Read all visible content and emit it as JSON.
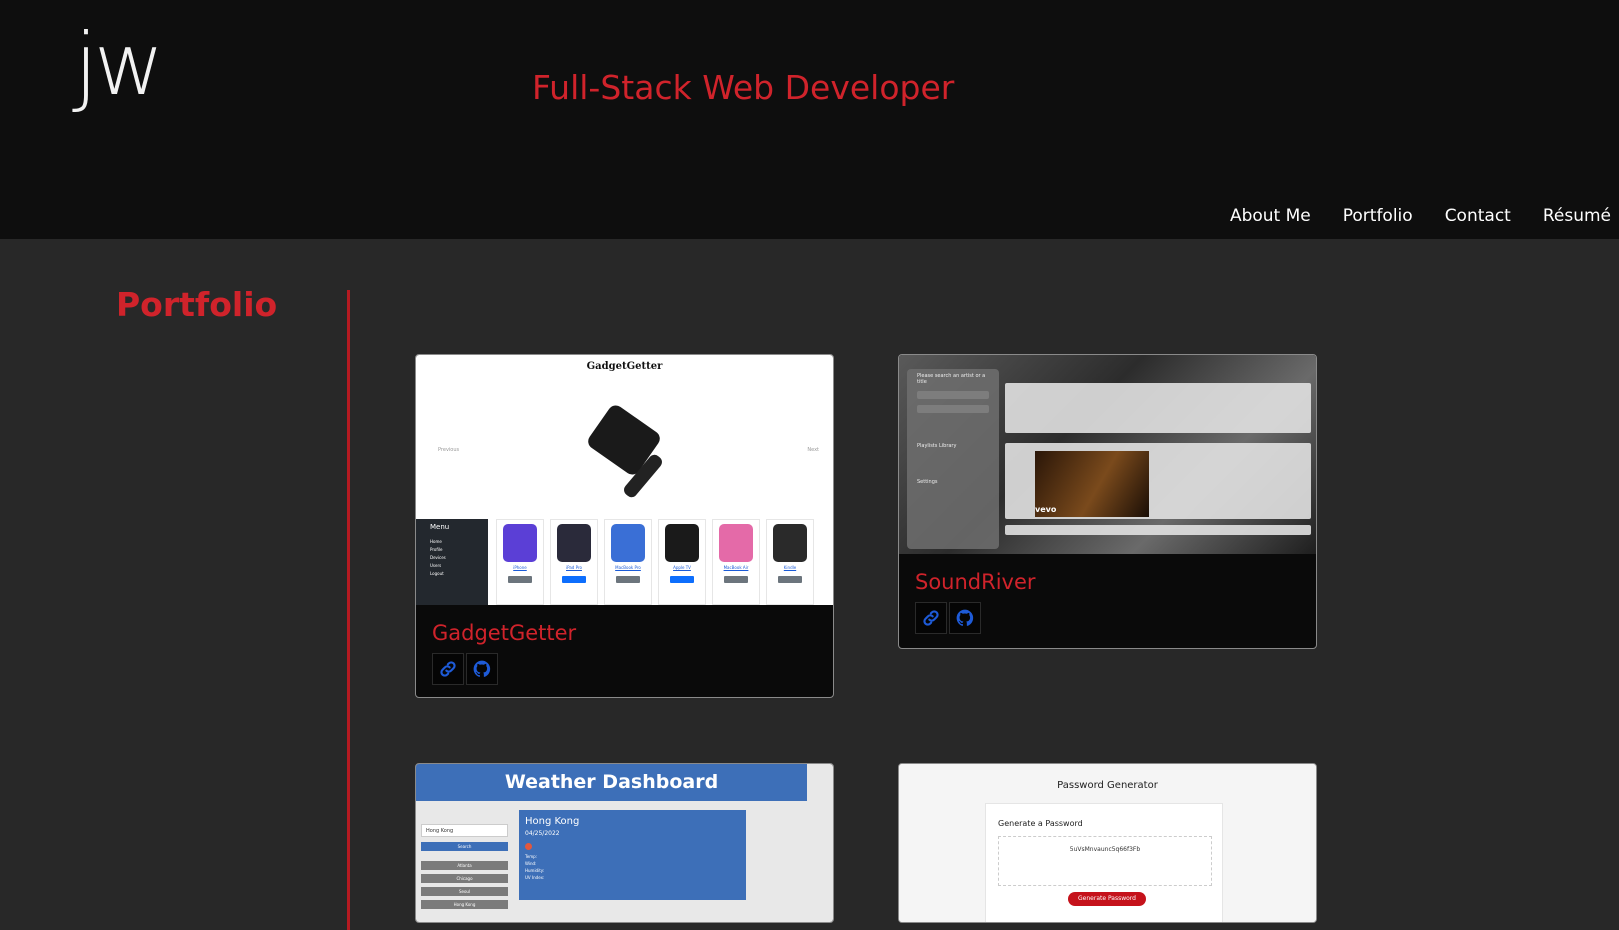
{
  "header": {
    "logo": "jw",
    "tagline": "Full-Stack Web Developer",
    "nav": [
      "About Me",
      "Portfolio",
      "Contact",
      "Résumé"
    ]
  },
  "section": {
    "title": "Portfolio"
  },
  "projects": [
    {
      "title": "GadgetGetter",
      "screenshot": {
        "app_title": "GadgetGetter",
        "prev": "Previous",
        "next": "Next",
        "menu": [
          "Menu",
          "Home",
          "Profile",
          "Devices",
          "Users",
          "Logout"
        ],
        "products": [
          {
            "name": "iPhone",
            "button": "Unavailable",
            "color": "#5b3fd6"
          },
          {
            "name": "iPad Pro",
            "button": "Rent this",
            "color": "#2a2a3a"
          },
          {
            "name": "MacBook Pro",
            "button": "Unavailable",
            "color": "#3a6fd6"
          },
          {
            "name": "Apple TV",
            "button": "Rent this",
            "color": "#1a1a1a"
          },
          {
            "name": "MacBook Air",
            "button": "Unavailable",
            "color": "#e46aa8"
          },
          {
            "name": "Kindle",
            "button": "Unavailable",
            "color": "#2a2a2a"
          }
        ]
      },
      "link_icon": "link-icon",
      "repo_icon": "github-icon"
    },
    {
      "title": "SoundRiver",
      "screenshot": {
        "search_prompt": "Please search an artist or a title",
        "playlist_label": "Playlists Library",
        "settings_label": "Settings",
        "video_brand": "vevo"
      },
      "link_icon": "link-icon",
      "repo_icon": "github-icon"
    },
    {
      "title": "Weather Dashboard",
      "screenshot": {
        "header": "Weather Dashboard",
        "search_value": "Hong Kong",
        "search_button": "Search",
        "history": [
          "Atlanta",
          "Chicago",
          "Seoul",
          "Hong Kong"
        ],
        "city": "Hong Kong",
        "date": "04/25/2022",
        "rows": [
          "Temp:",
          "Wind:",
          "Humidity:",
          "UV Index:"
        ]
      }
    },
    {
      "title": "Password Generator",
      "screenshot": {
        "header": "Password Generator",
        "card_title": "Generate a Password",
        "password": "5uVsMnvaunc5q66f3Fb",
        "button": "Generate Password"
      }
    }
  ],
  "colors": {
    "accent": "#d0232b",
    "header_bg": "#0e0e0e",
    "page_bg": "#282828",
    "icon_blue": "#1e5bd8"
  }
}
